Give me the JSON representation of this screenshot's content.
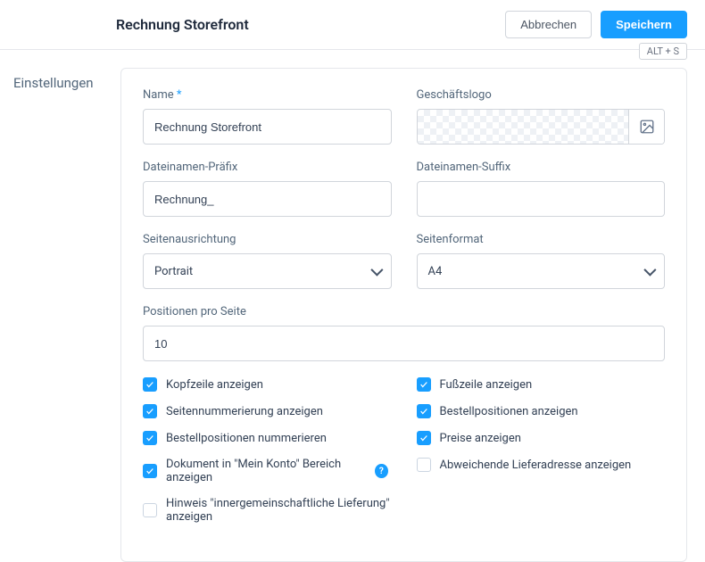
{
  "header": {
    "title": "Rechnung Storefront",
    "cancel": "Abbrechen",
    "save": "Speichern",
    "shortcut": "ALT + S"
  },
  "sideLabel": "Einstellungen",
  "fields": {
    "name": {
      "label": "Name",
      "required": "*",
      "value": "Rechnung Storefront"
    },
    "logo": {
      "label": "Geschäftslogo"
    },
    "prefix": {
      "label": "Dateinamen-Präfix",
      "value": "Rechnung_"
    },
    "suffix": {
      "label": "Dateinamen-Suffix",
      "value": ""
    },
    "orientation": {
      "label": "Seitenausrichtung",
      "value": "Portrait"
    },
    "format": {
      "label": "Seitenformat",
      "value": "A4"
    },
    "perPage": {
      "label": "Positionen pro Seite",
      "value": "10"
    }
  },
  "checks": {
    "left": [
      {
        "label": "Kopfzeile anzeigen",
        "checked": true
      },
      {
        "label": "Seitennummerierung anzeigen",
        "checked": true
      },
      {
        "label": "Bestellpositionen nummerieren",
        "checked": true
      },
      {
        "label": "Dokument in \"Mein Konto\" Bereich anzeigen",
        "checked": true,
        "help": true
      },
      {
        "label": "Hinweis \"innergemeinschaftliche Lieferung\" anzeigen",
        "checked": false
      }
    ],
    "right": [
      {
        "label": "Fußzeile anzeigen",
        "checked": true
      },
      {
        "label": "Bestellpositionen anzeigen",
        "checked": true
      },
      {
        "label": "Preise anzeigen",
        "checked": true
      },
      {
        "label": "Abweichende Lieferadresse anzeigen",
        "checked": false
      }
    ]
  }
}
